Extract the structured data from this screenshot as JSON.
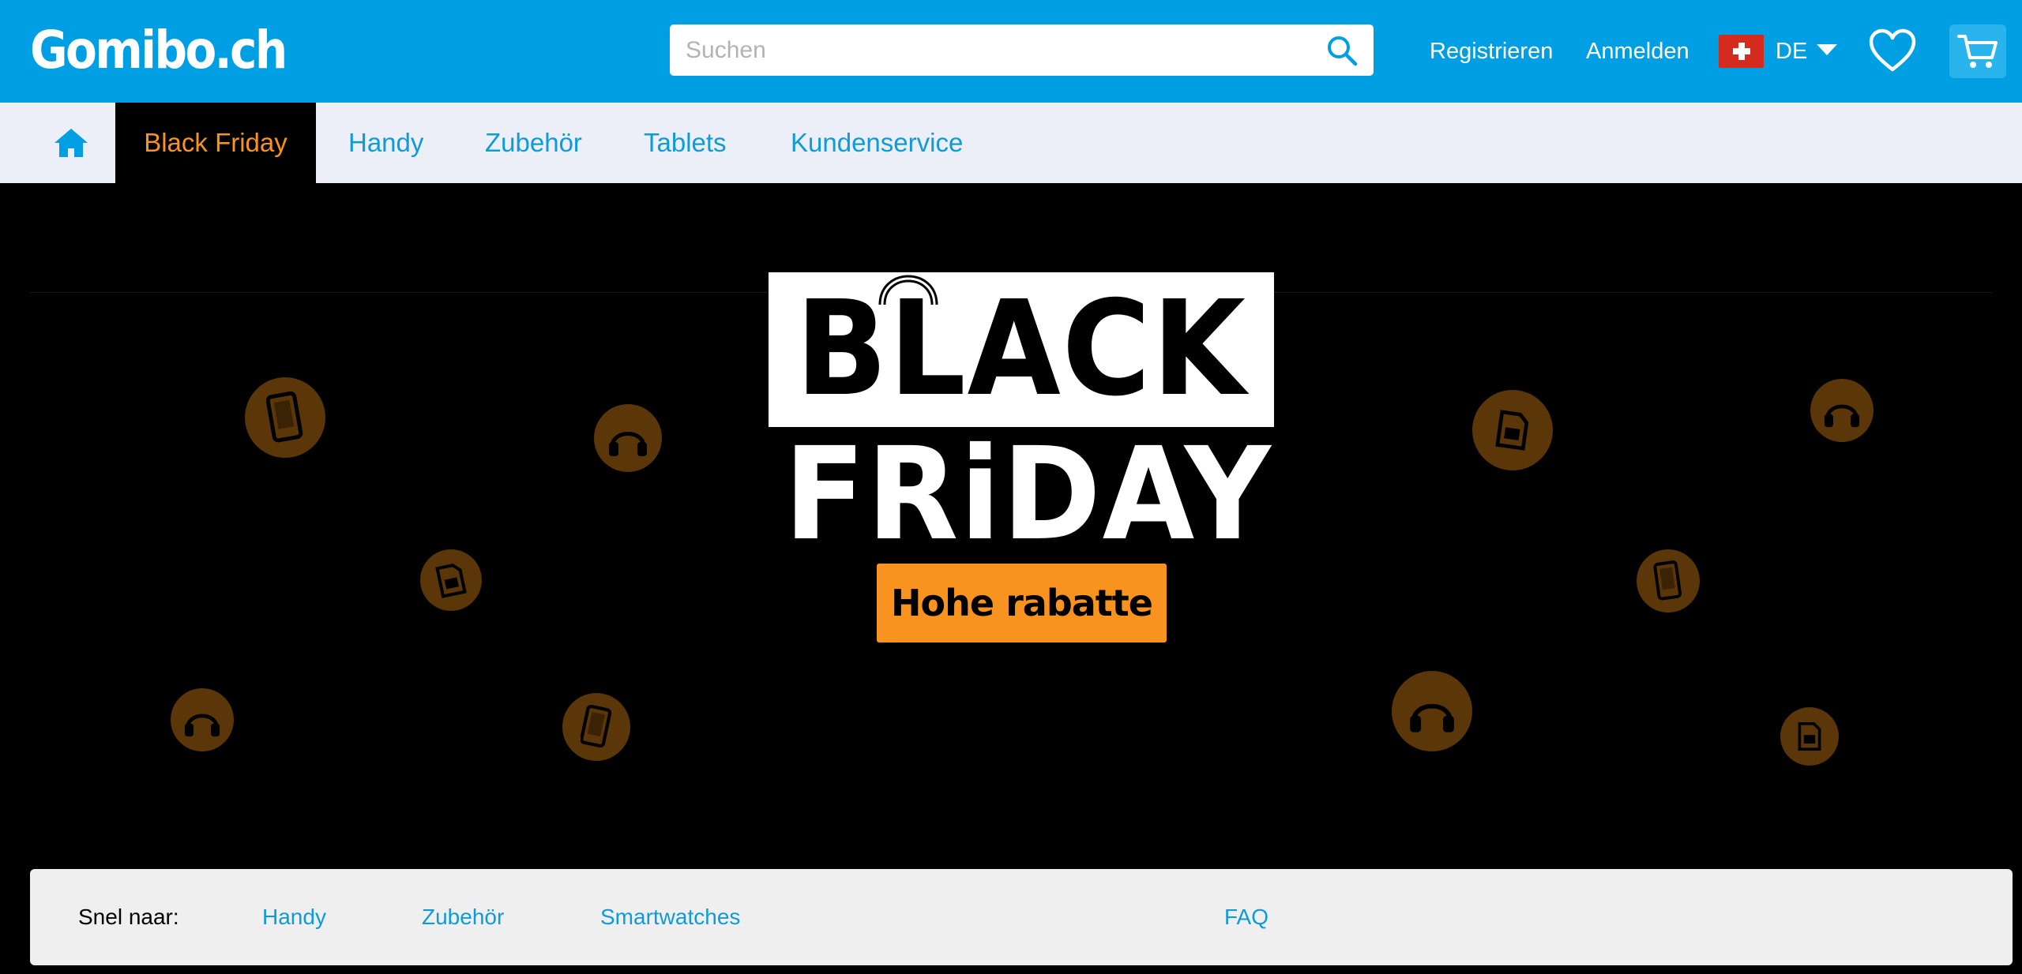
{
  "header": {
    "logo": "Gomibo.ch",
    "search_placeholder": "Suchen",
    "register": "Registrieren",
    "login": "Anmelden",
    "language": "DE",
    "icons": {
      "search": "search-icon",
      "flag": "swiss-flag-icon",
      "wishlist": "heart-icon",
      "cart": "cart-icon"
    }
  },
  "nav": {
    "home_icon": "home-icon",
    "items": [
      "Black Friday",
      "Handy",
      "Zubehör",
      "Tablets",
      "Kundenservice"
    ]
  },
  "banner": {
    "line1": "BLACK",
    "line2": "FRiDAY",
    "cta": "Hohe rabatte"
  },
  "quick_links": {
    "label": "Snel naar:",
    "items": [
      "Handy",
      "Zubehör",
      "Smartwatches",
      "FAQ"
    ]
  },
  "colors": {
    "header_bg": "#009fe3",
    "nav_bg": "#eceff7",
    "link": "#0f9bd7",
    "accent_orange": "#f7931e",
    "hero_bg": "#000000"
  }
}
